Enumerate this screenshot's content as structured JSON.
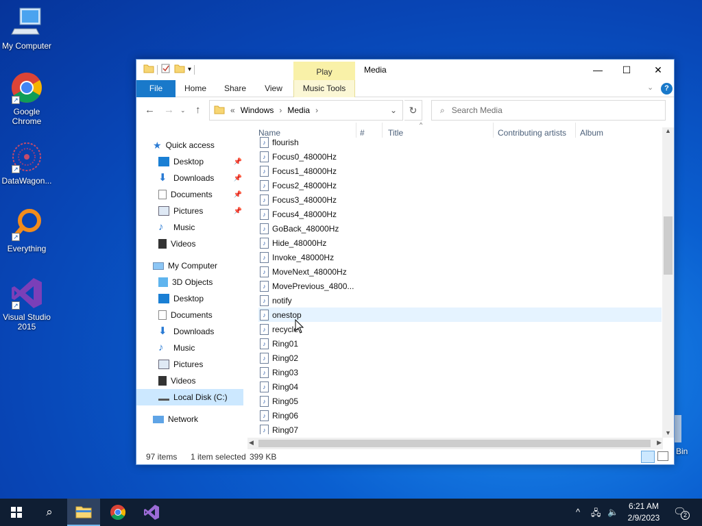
{
  "desktop": {
    "icons": [
      {
        "label": "My Computer"
      },
      {
        "label": "Google Chrome"
      },
      {
        "label": "DataWagon..."
      },
      {
        "label": "Everything"
      },
      {
        "label": "Visual Studio 2015"
      },
      {
        "label": "Bin"
      }
    ]
  },
  "window": {
    "title": "Media",
    "contextual_tab": "Play",
    "ribbon_tabs": [
      "File",
      "Home",
      "Share",
      "View",
      "Music Tools"
    ],
    "address": {
      "crumbs": [
        "«",
        "Windows",
        "Media"
      ]
    },
    "search_placeholder": "Search Media",
    "nav": {
      "quick_access": "Quick access",
      "quick_items": [
        "Desktop",
        "Downloads",
        "Documents",
        "Pictures",
        "Music",
        "Videos"
      ],
      "computer": "My Computer",
      "computer_items": [
        "3D Objects",
        "Desktop",
        "Documents",
        "Downloads",
        "Music",
        "Pictures",
        "Videos",
        "Local Disk (C:)"
      ],
      "network": "Network"
    },
    "columns": [
      "Name",
      "#",
      "Title",
      "Contributing artists",
      "Album"
    ],
    "files": [
      "flourish",
      "Focus0_48000Hz",
      "Focus1_48000Hz",
      "Focus2_48000Hz",
      "Focus3_48000Hz",
      "Focus4_48000Hz",
      "GoBack_48000Hz",
      "Hide_48000Hz",
      "Invoke_48000Hz",
      "MoveNext_48000Hz",
      "MovePrevious_4800...",
      "notify",
      "onestop",
      "recycle",
      "Ring01",
      "Ring02",
      "Ring03",
      "Ring04",
      "Ring05",
      "Ring06",
      "Ring07"
    ],
    "status": {
      "count": "97 items",
      "selected": "1 item selected",
      "size": "399 KB"
    }
  },
  "taskbar": {
    "time": "6:21 AM",
    "date": "2/9/2023",
    "notifications": "2"
  }
}
